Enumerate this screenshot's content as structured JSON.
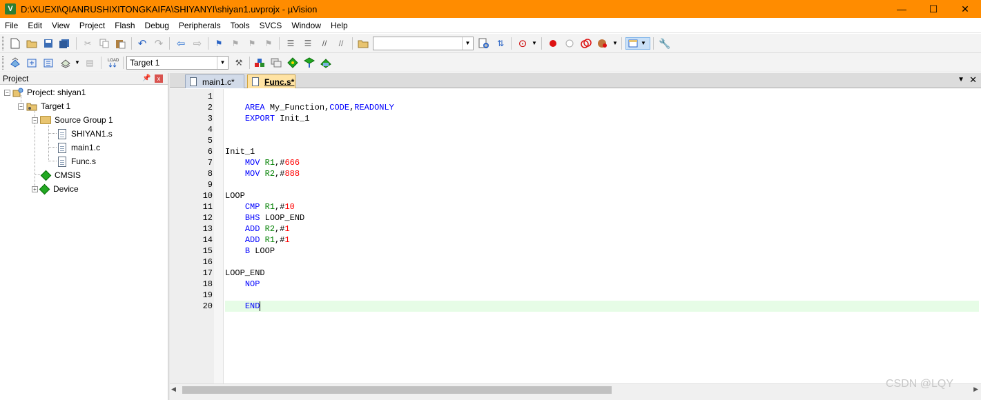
{
  "window": {
    "title": "D:\\XUEXI\\QIANRUSHIXITONGKAIFA\\SHIYANYI\\shiyan1.uvprojx - µVision",
    "minimize": "—",
    "maximize": "☐",
    "close": "✕"
  },
  "menu": [
    "File",
    "Edit",
    "View",
    "Project",
    "Flash",
    "Debug",
    "Peripherals",
    "Tools",
    "SVCS",
    "Window",
    "Help"
  ],
  "toolbar2": {
    "target_select": "Target 1"
  },
  "project_panel": {
    "title": "Project",
    "pin": "ᵖ",
    "close": "x",
    "tree": {
      "root": "Project: shiyan1",
      "target": "Target 1",
      "group": "Source Group 1",
      "files": [
        "SHIYAN1.s",
        "main1.c",
        "Func.s"
      ],
      "cmsis": "CMSIS",
      "device": "Device"
    }
  },
  "tabs": [
    {
      "label": "main1.c*",
      "active": false
    },
    {
      "label": "Func.s*",
      "active": true
    }
  ],
  "editor": {
    "current_line": 20,
    "lines": [
      {
        "n": "1",
        "indent": "",
        "tokens": []
      },
      {
        "n": "2",
        "indent": "    ",
        "tokens": [
          [
            "kw",
            "AREA"
          ],
          [
            "t",
            " My_Function,"
          ],
          [
            "kw",
            "CODE"
          ],
          [
            "t",
            ","
          ],
          [
            "kw",
            "READONLY"
          ]
        ]
      },
      {
        "n": "3",
        "indent": "    ",
        "tokens": [
          [
            "kw",
            "EXPORT"
          ],
          [
            "t",
            " Init_1"
          ]
        ]
      },
      {
        "n": "4",
        "indent": "",
        "tokens": []
      },
      {
        "n": "5",
        "indent": "",
        "tokens": []
      },
      {
        "n": "6",
        "indent": "",
        "tokens": [
          [
            "t",
            "Init_1"
          ]
        ]
      },
      {
        "n": "7",
        "indent": "    ",
        "tokens": [
          [
            "kw",
            "MOV"
          ],
          [
            "t",
            " "
          ],
          [
            "reg",
            "R1"
          ],
          [
            "t",
            ",#"
          ],
          [
            "num",
            "666"
          ]
        ]
      },
      {
        "n": "8",
        "indent": "    ",
        "tokens": [
          [
            "kw",
            "MOV"
          ],
          [
            "t",
            " "
          ],
          [
            "reg",
            "R2"
          ],
          [
            "t",
            ",#"
          ],
          [
            "num",
            "888"
          ]
        ]
      },
      {
        "n": "9",
        "indent": "",
        "tokens": []
      },
      {
        "n": "10",
        "indent": "",
        "tokens": [
          [
            "t",
            "LOOP"
          ]
        ]
      },
      {
        "n": "11",
        "indent": "    ",
        "tokens": [
          [
            "kw",
            "CMP"
          ],
          [
            "t",
            " "
          ],
          [
            "reg",
            "R1"
          ],
          [
            "t",
            ",#"
          ],
          [
            "num",
            "10"
          ]
        ]
      },
      {
        "n": "12",
        "indent": "    ",
        "tokens": [
          [
            "kw",
            "BHS"
          ],
          [
            "t",
            " LOOP_END"
          ]
        ]
      },
      {
        "n": "13",
        "indent": "    ",
        "tokens": [
          [
            "kw",
            "ADD"
          ],
          [
            "t",
            " "
          ],
          [
            "reg",
            "R2"
          ],
          [
            "t",
            ",#"
          ],
          [
            "num",
            "1"
          ]
        ]
      },
      {
        "n": "14",
        "indent": "    ",
        "tokens": [
          [
            "kw",
            "ADD"
          ],
          [
            "t",
            " "
          ],
          [
            "reg",
            "R1"
          ],
          [
            "t",
            ",#"
          ],
          [
            "num",
            "1"
          ]
        ]
      },
      {
        "n": "15",
        "indent": "    ",
        "tokens": [
          [
            "kw",
            "B"
          ],
          [
            "t",
            " LOOP"
          ]
        ]
      },
      {
        "n": "16",
        "indent": "",
        "tokens": []
      },
      {
        "n": "17",
        "indent": "",
        "tokens": [
          [
            "t",
            "LOOP_END"
          ]
        ]
      },
      {
        "n": "18",
        "indent": "    ",
        "tokens": [
          [
            "kw",
            "NOP"
          ]
        ]
      },
      {
        "n": "19",
        "indent": "",
        "tokens": []
      },
      {
        "n": "20",
        "indent": "    ",
        "tokens": [
          [
            "kw",
            "END"
          ]
        ]
      }
    ]
  },
  "colors": {
    "titlebar": "#ff8c00",
    "keyword": "#0000ff",
    "register": "#008000",
    "number": "#ff0000",
    "current_line": "#e6fce6"
  },
  "watermark": "CSDN @LQY"
}
